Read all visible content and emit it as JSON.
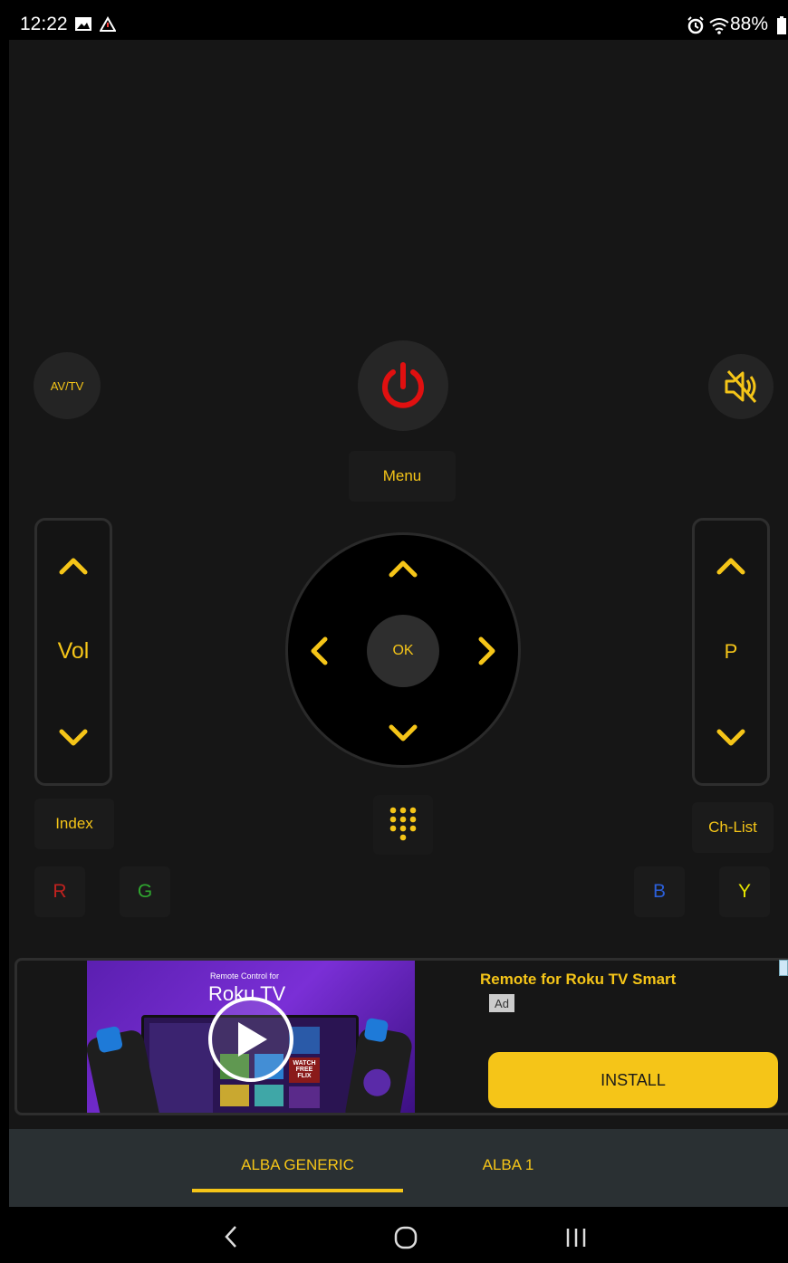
{
  "status_bar": {
    "time": "12:22",
    "battery": "88%",
    "icons": [
      "gallery-icon",
      "warning-icon",
      "alarm-icon",
      "wifi-icon",
      "battery-icon"
    ]
  },
  "remote": {
    "av_tv_label": "AV/TV",
    "menu_label": "Menu",
    "vol_label": "Vol",
    "program_label": "P",
    "ok_label": "OK",
    "index_label": "Index",
    "ch_list_label": "Ch-List",
    "color_keys": [
      {
        "label": "R",
        "color": "#c0221f"
      },
      {
        "label": "G",
        "color": "#2fa82f"
      },
      {
        "label": "B",
        "color": "#2b5fd9"
      },
      {
        "label": "Y",
        "color": "#e6e600"
      }
    ],
    "accent_color": "#f5c518",
    "power_color": "#e01010"
  },
  "ad": {
    "video_caption_small": "Remote Control for",
    "video_caption_large": "Roku TV",
    "title": "Remote for Roku TV Smart",
    "badge": "Ad",
    "install_label": "INSTALL",
    "tile_text": "WATCH FREE FLIX"
  },
  "tabs": [
    {
      "label": "ALBA GENERIC",
      "selected": true
    },
    {
      "label": "ALBA 1",
      "selected": false
    }
  ]
}
